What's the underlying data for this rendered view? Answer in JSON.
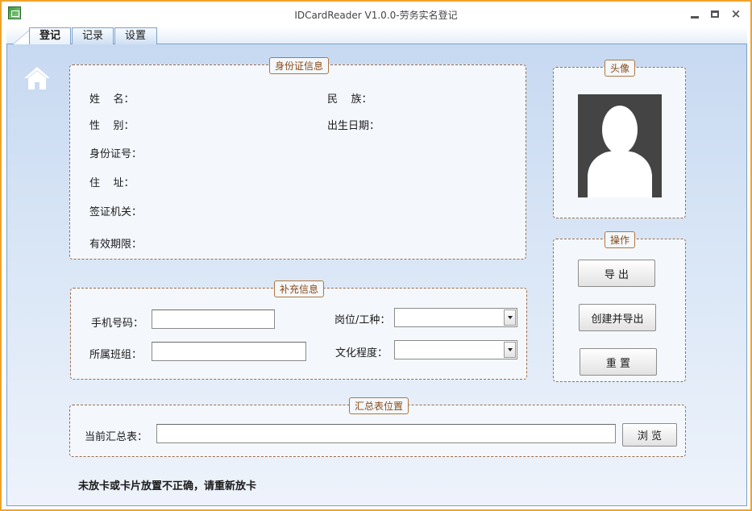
{
  "window": {
    "title": "IDCardReader  V1.0.0-劳务实名登记",
    "min_label": "",
    "close_label": "×"
  },
  "tabs": [
    {
      "label": "登记"
    },
    {
      "label": "记录"
    },
    {
      "label": "设置"
    }
  ],
  "id_info": {
    "legend": "身份证信息",
    "name_label": "姓    名：",
    "ethnic_label": "民    族：",
    "gender_label": "性    别：",
    "birth_label": "出生日期：",
    "id_label": "身份证号：",
    "address_label": "住    址：",
    "authority_label": "签证机关：",
    "validity_label": "有效期限："
  },
  "photo": {
    "legend": "头像"
  },
  "actions": {
    "legend": "操作",
    "export_label": "导 出",
    "create_export_label": "创建并导出",
    "reset_label": "重 置"
  },
  "extra_info": {
    "legend": "补充信息",
    "phone_label": "手机号码：",
    "post_label": "岗位/工种：",
    "team_label": "所属班组：",
    "education_label": "文化程度："
  },
  "summary": {
    "legend": "汇总表位置",
    "current_label": "当前汇总表：",
    "browse_label": "浏 览"
  },
  "status_text": "未放卡或卡片放置不正确，请重新放卡",
  "icons": {
    "app": "app-icon",
    "home": "home-icon",
    "avatar": "person-silhouette-icon"
  },
  "colors": {
    "window_border": "#f0a32a",
    "legend_text": "#8a4a14",
    "background_top": "#c7d9f1",
    "background_bottom": "#eef3fb"
  }
}
